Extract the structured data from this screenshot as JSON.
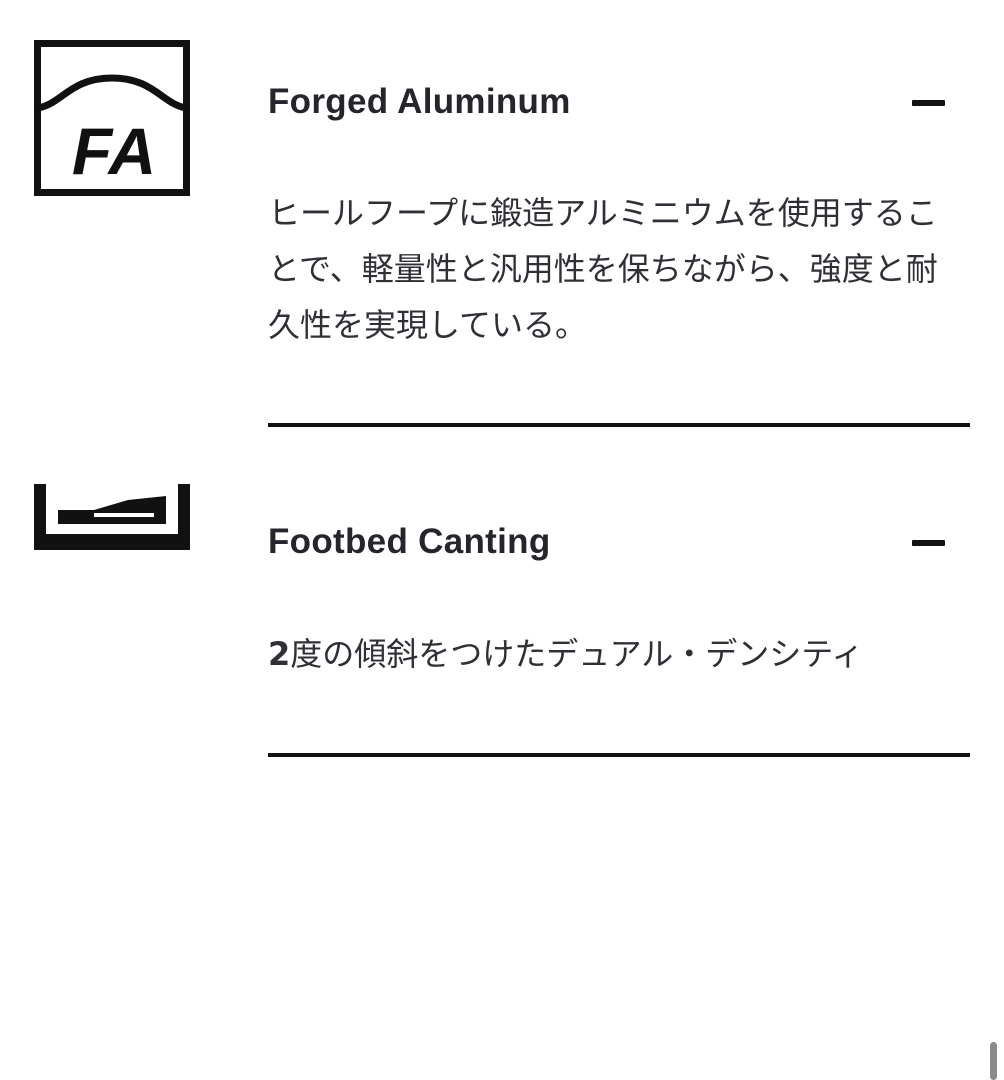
{
  "features": [
    {
      "icon": "forged-aluminum-icon",
      "icon_text": "FA",
      "title": "Forged Aluminum",
      "toggle_icon": "minus-icon",
      "expanded": true,
      "description": "ヒールフープに鍛造アルミニウムを使用することで、軽量性と汎用性を保ちながら、強度と耐久性を実現している。"
    },
    {
      "icon": "footbed-canting-icon",
      "title": "Footbed Canting",
      "toggle_icon": "minus-icon",
      "expanded": true,
      "description_number": "2",
      "description_rest": "度の傾斜をつけたデュアル・デンシティ"
    }
  ],
  "colors": {
    "text": "#24262b",
    "icon": "#111111",
    "background": "#ffffff"
  }
}
